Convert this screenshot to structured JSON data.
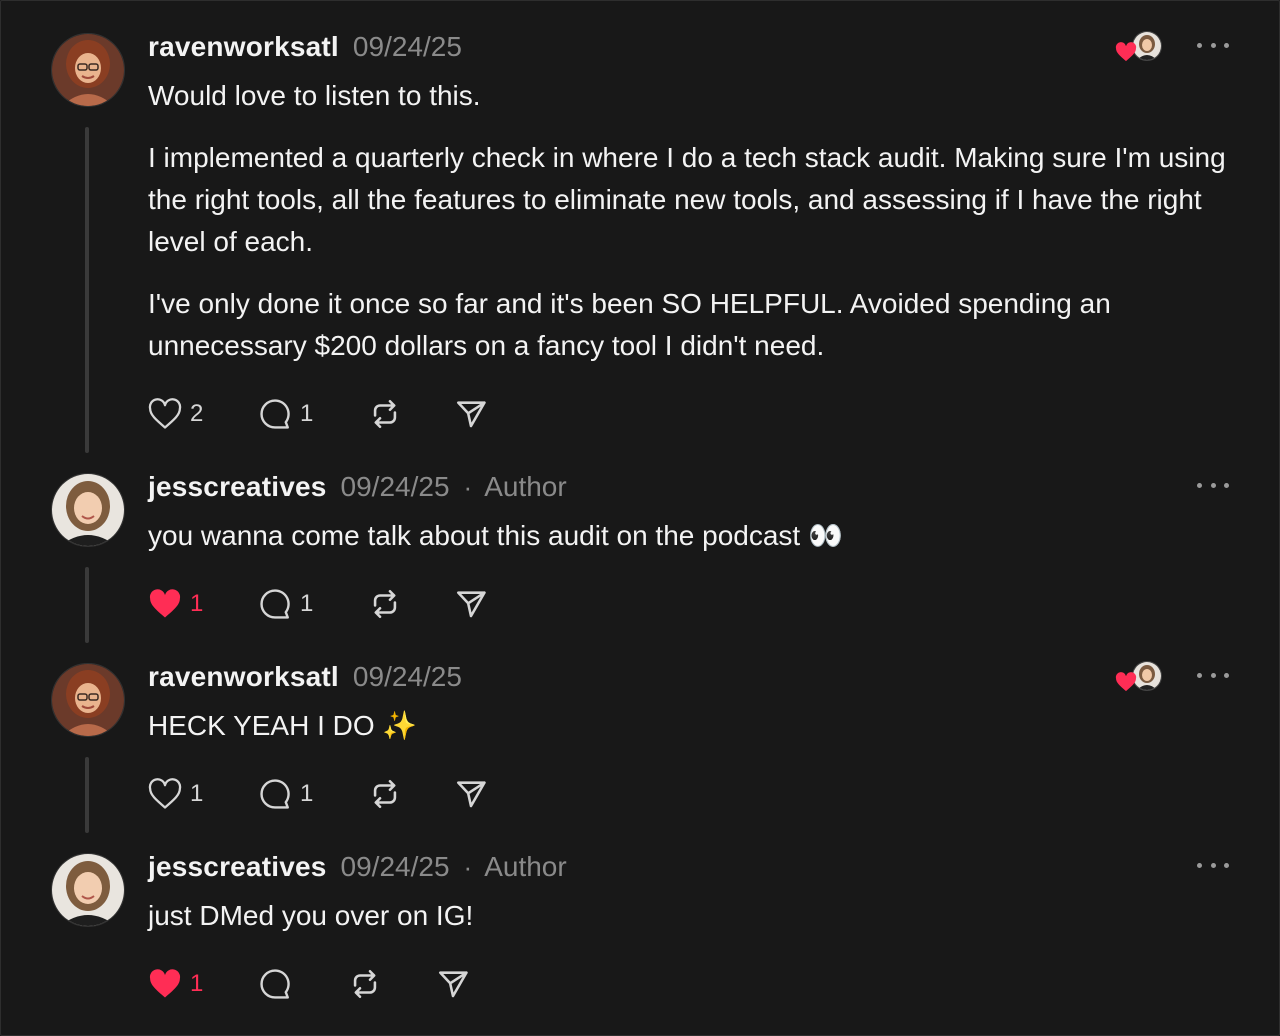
{
  "colors": {
    "background": "#181818",
    "accent_like": "#ff2d55",
    "muted": "#8a8a8a"
  },
  "comments": [
    {
      "username": "ravenworksatl",
      "date": "09/24/25",
      "author_badge": "",
      "paragraphs": [
        "Would love to listen to this.",
        "I implemented a quarterly check in where I do a tech stack audit. Making sure I'm using the right tools, all the features to eliminate new tools, and assessing if I have the right level of each.",
        "I've only done it once so far and it's been SO HELPFUL. Avoided spending an unnecessary $200 dollars on a fancy tool I didn't need."
      ],
      "likes": "2",
      "replies": "1",
      "liked": false,
      "liked_by_author": true
    },
    {
      "username": "jesscreatives",
      "date": "09/24/25",
      "dot": "·",
      "author_badge": "Author",
      "paragraphs": [
        "you wanna come talk about this audit on the podcast 👀"
      ],
      "likes": "1",
      "replies": "1",
      "liked": true,
      "liked_by_author": false
    },
    {
      "username": "ravenworksatl",
      "date": "09/24/25",
      "author_badge": "",
      "paragraphs": [
        "HECK YEAH I DO ✨"
      ],
      "likes": "1",
      "replies": "1",
      "liked": false,
      "liked_by_author": true
    },
    {
      "username": "jesscreatives",
      "date": "09/24/25",
      "dot": "·",
      "author_badge": "Author",
      "paragraphs": [
        "just DMed you over on IG!"
      ],
      "likes": "1",
      "replies": "",
      "liked": true,
      "liked_by_author": false
    }
  ],
  "icons": {
    "like": "heart-icon",
    "reply": "speech-bubble-icon",
    "repost": "repost-icon",
    "share": "paper-plane-icon",
    "more": "ellipsis-icon"
  }
}
